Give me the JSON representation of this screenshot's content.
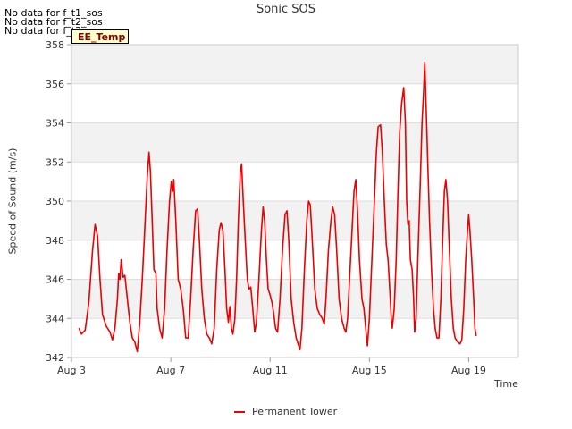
{
  "no_data_messages": [
    "No data for f_t1_sos",
    "No data for f_t2_sos",
    "No data for f_t3_sos"
  ],
  "badge": "EE_Temp",
  "chart_data": {
    "type": "line",
    "title": "Sonic SOS",
    "xlabel": "Time",
    "ylabel": "Speed of Sound (m/s)",
    "xlim": [
      0,
      18
    ],
    "ylim": [
      342,
      358
    ],
    "x_axis_origin": "Aug 3",
    "x_units": "days since Aug 3",
    "x_ticks": [
      {
        "x": 0,
        "label": "Aug 3"
      },
      {
        "x": 4,
        "label": "Aug 7"
      },
      {
        "x": 8,
        "label": "Aug 11"
      },
      {
        "x": 12,
        "label": "Aug 15"
      },
      {
        "x": 16,
        "label": "Aug 19"
      }
    ],
    "y_ticks": [
      342,
      344,
      346,
      348,
      350,
      352,
      354,
      356,
      358
    ],
    "grid": true,
    "legend_position": "bottom-center",
    "series": [
      {
        "name": "Permanent Tower",
        "color": "#ee0000",
        "points": [
          [
            0.3,
            343.5
          ],
          [
            0.4,
            343.2
          ],
          [
            0.55,
            343.4
          ],
          [
            0.7,
            344.8
          ],
          [
            0.85,
            347.5
          ],
          [
            0.95,
            348.8
          ],
          [
            1.05,
            348.2
          ],
          [
            1.15,
            346.0
          ],
          [
            1.25,
            344.2
          ],
          [
            1.4,
            343.6
          ],
          [
            1.55,
            343.3
          ],
          [
            1.65,
            342.9
          ],
          [
            1.75,
            343.5
          ],
          [
            1.85,
            345.0
          ],
          [
            1.9,
            346.3
          ],
          [
            1.95,
            346.0
          ],
          [
            2.0,
            347.0
          ],
          [
            2.08,
            346.1
          ],
          [
            2.15,
            346.2
          ],
          [
            2.25,
            345.0
          ],
          [
            2.35,
            343.8
          ],
          [
            2.45,
            343.0
          ],
          [
            2.55,
            342.8
          ],
          [
            2.65,
            342.3
          ],
          [
            2.75,
            343.8
          ],
          [
            2.85,
            346.0
          ],
          [
            2.95,
            348.5
          ],
          [
            3.05,
            351.2
          ],
          [
            3.12,
            352.5
          ],
          [
            3.18,
            351.5
          ],
          [
            3.25,
            349.0
          ],
          [
            3.32,
            346.5
          ],
          [
            3.4,
            346.3
          ],
          [
            3.45,
            344.5
          ],
          [
            3.55,
            343.5
          ],
          [
            3.65,
            343.0
          ],
          [
            3.75,
            344.5
          ],
          [
            3.85,
            347.5
          ],
          [
            3.95,
            350.0
          ],
          [
            4.02,
            351.0
          ],
          [
            4.08,
            350.5
          ],
          [
            4.12,
            351.1
          ],
          [
            4.2,
            349.0
          ],
          [
            4.3,
            346.0
          ],
          [
            4.4,
            345.5
          ],
          [
            4.5,
            344.5
          ],
          [
            4.6,
            343.0
          ],
          [
            4.7,
            343.0
          ],
          [
            4.8,
            345.0
          ],
          [
            4.9,
            347.5
          ],
          [
            5.0,
            349.5
          ],
          [
            5.08,
            349.6
          ],
          [
            5.15,
            348.0
          ],
          [
            5.25,
            345.5
          ],
          [
            5.35,
            344.0
          ],
          [
            5.45,
            343.2
          ],
          [
            5.55,
            343.0
          ],
          [
            5.65,
            342.7
          ],
          [
            5.75,
            343.5
          ],
          [
            5.85,
            346.5
          ],
          [
            5.95,
            348.5
          ],
          [
            6.02,
            348.9
          ],
          [
            6.1,
            348.5
          ],
          [
            6.18,
            346.5
          ],
          [
            6.25,
            344.5
          ],
          [
            6.32,
            343.8
          ],
          [
            6.38,
            344.6
          ],
          [
            6.44,
            343.5
          ],
          [
            6.5,
            343.2
          ],
          [
            6.58,
            344.0
          ],
          [
            6.65,
            346.0
          ],
          [
            6.72,
            349.0
          ],
          [
            6.8,
            351.5
          ],
          [
            6.85,
            351.9
          ],
          [
            6.92,
            350.0
          ],
          [
            7.0,
            348.0
          ],
          [
            7.08,
            346.0
          ],
          [
            7.15,
            345.5
          ],
          [
            7.22,
            345.6
          ],
          [
            7.3,
            344.5
          ],
          [
            7.38,
            343.3
          ],
          [
            7.45,
            343.8
          ],
          [
            7.55,
            346.0
          ],
          [
            7.65,
            348.5
          ],
          [
            7.72,
            349.7
          ],
          [
            7.78,
            349.0
          ],
          [
            7.85,
            347.0
          ],
          [
            7.92,
            345.5
          ],
          [
            8.0,
            345.2
          ],
          [
            8.08,
            344.8
          ],
          [
            8.15,
            344.2
          ],
          [
            8.22,
            343.5
          ],
          [
            8.3,
            343.3
          ],
          [
            8.4,
            345.0
          ],
          [
            8.5,
            347.5
          ],
          [
            8.6,
            349.3
          ],
          [
            8.68,
            349.5
          ],
          [
            8.75,
            348.0
          ],
          [
            8.85,
            345.0
          ],
          [
            8.95,
            343.8
          ],
          [
            9.05,
            343.0
          ],
          [
            9.15,
            342.6
          ],
          [
            9.2,
            342.4
          ],
          [
            9.28,
            343.5
          ],
          [
            9.38,
            346.5
          ],
          [
            9.48,
            349.0
          ],
          [
            9.55,
            350.0
          ],
          [
            9.62,
            349.8
          ],
          [
            9.7,
            348.0
          ],
          [
            9.8,
            345.5
          ],
          [
            9.9,
            344.5
          ],
          [
            10.0,
            344.2
          ],
          [
            10.1,
            344.0
          ],
          [
            10.18,
            343.7
          ],
          [
            10.25,
            345.0
          ],
          [
            10.35,
            347.5
          ],
          [
            10.45,
            349.0
          ],
          [
            10.52,
            349.7
          ],
          [
            10.6,
            349.3
          ],
          [
            10.68,
            347.5
          ],
          [
            10.78,
            345.0
          ],
          [
            10.88,
            344.0
          ],
          [
            10.98,
            343.5
          ],
          [
            11.05,
            343.3
          ],
          [
            11.12,
            344.0
          ],
          [
            11.2,
            346.0
          ],
          [
            11.3,
            348.5
          ],
          [
            11.38,
            350.5
          ],
          [
            11.45,
            351.1
          ],
          [
            11.52,
            349.5
          ],
          [
            11.6,
            347.0
          ],
          [
            11.7,
            345.0
          ],
          [
            11.78,
            344.5
          ],
          [
            11.85,
            343.5
          ],
          [
            11.92,
            342.6
          ],
          [
            12.0,
            344.0
          ],
          [
            12.1,
            347.0
          ],
          [
            12.2,
            350.0
          ],
          [
            12.28,
            352.5
          ],
          [
            12.35,
            353.8
          ],
          [
            12.45,
            353.9
          ],
          [
            12.52,
            352.5
          ],
          [
            12.6,
            350.0
          ],
          [
            12.68,
            347.8
          ],
          [
            12.75,
            347.0
          ],
          [
            12.82,
            345.5
          ],
          [
            12.88,
            344.0
          ],
          [
            12.92,
            343.5
          ],
          [
            13.0,
            344.5
          ],
          [
            13.08,
            347.0
          ],
          [
            13.15,
            350.5
          ],
          [
            13.22,
            353.5
          ],
          [
            13.3,
            355.0
          ],
          [
            13.38,
            355.8
          ],
          [
            13.45,
            354.0
          ],
          [
            13.5,
            350.0
          ],
          [
            13.55,
            348.8
          ],
          [
            13.6,
            349.0
          ],
          [
            13.65,
            347.0
          ],
          [
            13.72,
            346.5
          ],
          [
            13.78,
            345.0
          ],
          [
            13.82,
            343.3
          ],
          [
            13.88,
            344.0
          ],
          [
            13.95,
            347.0
          ],
          [
            14.05,
            351.0
          ],
          [
            14.12,
            354.0
          ],
          [
            14.18,
            355.5
          ],
          [
            14.23,
            357.1
          ],
          [
            14.28,
            355.0
          ],
          [
            14.35,
            352.0
          ],
          [
            14.42,
            349.0
          ],
          [
            14.5,
            346.5
          ],
          [
            14.58,
            344.5
          ],
          [
            14.65,
            343.5
          ],
          [
            14.72,
            343.0
          ],
          [
            14.8,
            343.0
          ],
          [
            14.88,
            345.0
          ],
          [
            14.95,
            348.0
          ],
          [
            15.02,
            350.5
          ],
          [
            15.08,
            351.1
          ],
          [
            15.15,
            350.0
          ],
          [
            15.22,
            347.5
          ],
          [
            15.3,
            345.0
          ],
          [
            15.38,
            343.5
          ],
          [
            15.45,
            343.0
          ],
          [
            15.55,
            342.8
          ],
          [
            15.65,
            342.7
          ],
          [
            15.72,
            342.9
          ],
          [
            15.8,
            344.5
          ],
          [
            15.88,
            347.0
          ],
          [
            15.95,
            348.5
          ],
          [
            16.0,
            349.3
          ],
          [
            16.05,
            348.5
          ],
          [
            16.12,
            347.0
          ],
          [
            16.2,
            345.0
          ],
          [
            16.25,
            343.5
          ],
          [
            16.3,
            343.1
          ]
        ]
      }
    ]
  }
}
